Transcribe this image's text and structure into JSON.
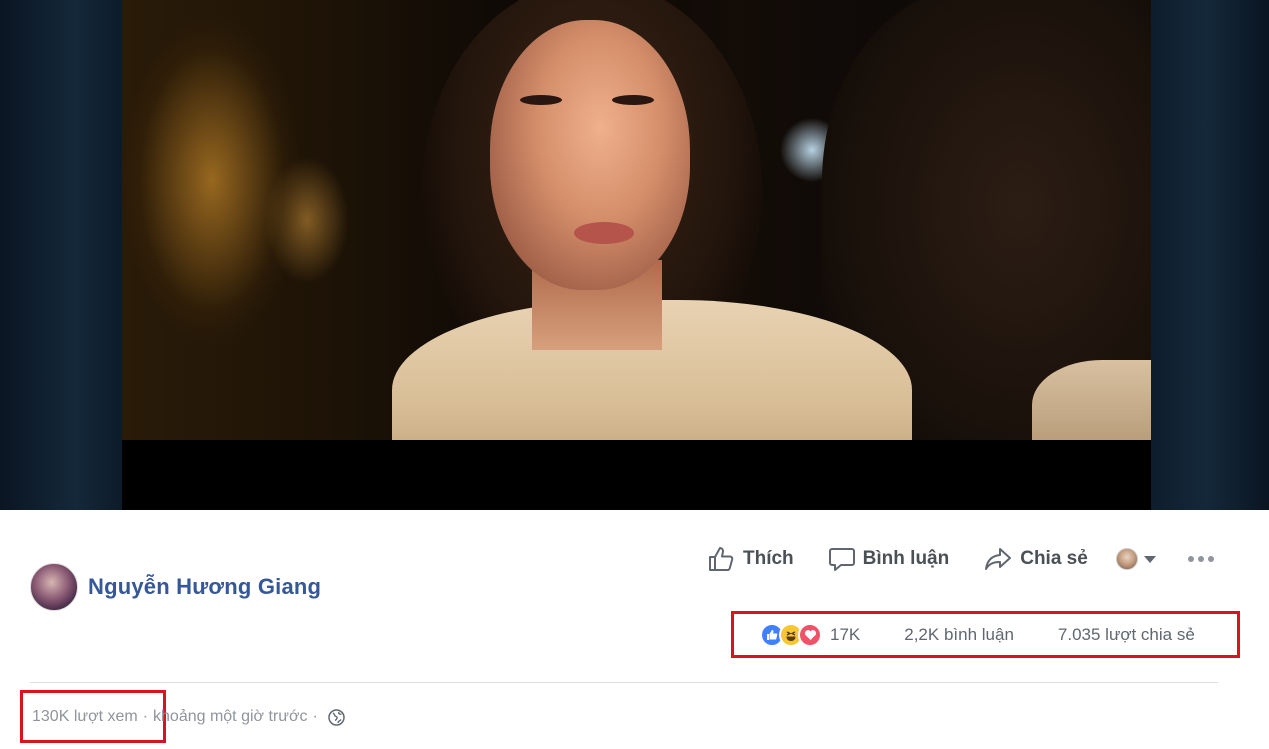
{
  "post": {
    "author": {
      "name": "Nguyễn Hương Giang",
      "avatar_icon": "profile-photo"
    },
    "actions": {
      "like_label": "Thích",
      "comment_label": "Bình luận",
      "share_label": "Chia sẻ"
    },
    "reactions": {
      "types": [
        "like-icon",
        "haha-icon",
        "love-icon"
      ],
      "count": "17K",
      "comments": "2,2K bình luận",
      "shares": "7.035 lượt chia sẻ"
    },
    "meta": {
      "views": "130K lượt xem",
      "separator": "·",
      "time": "khoảng một giờ trước",
      "privacy_icon": "globe-icon"
    }
  },
  "colors": {
    "author_link": "#365899",
    "action_text": "#4b4f56",
    "meta_text": "#90949c",
    "highlight_box": "#d9141c",
    "like_blue": "#4080ff",
    "love_red": "#f25268",
    "haha_yellow": "#f7c635"
  }
}
